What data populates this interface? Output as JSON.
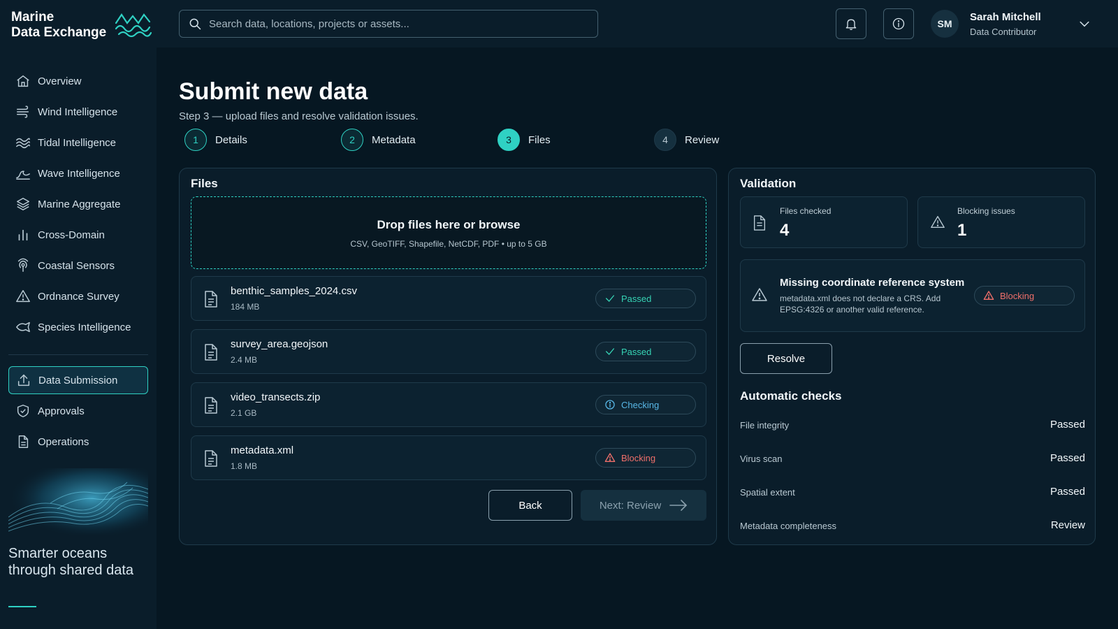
{
  "brand": {
    "line1": "Marine",
    "line2": "Data Exchange"
  },
  "search": {
    "placeholder": "Search data, locations, projects or assets..."
  },
  "user": {
    "initials": "SM",
    "name": "Sarah Mitchell",
    "role": "Data Contributor"
  },
  "sidebar": {
    "items": [
      {
        "label": "Overview",
        "icon": "home-icon"
      },
      {
        "label": "Wind Intelligence",
        "icon": "wind-icon"
      },
      {
        "label": "Tidal Intelligence",
        "icon": "tidal-icon"
      },
      {
        "label": "Wave Intelligence",
        "icon": "wave-icon"
      },
      {
        "label": "Marine Aggregate",
        "icon": "layers-icon"
      },
      {
        "label": "Cross-Domain",
        "icon": "bar-chart-icon"
      },
      {
        "label": "Coastal Sensors",
        "icon": "sensor-icon"
      },
      {
        "label": "Ordnance Survey",
        "icon": "warning-icon"
      },
      {
        "label": "Species Intelligence",
        "icon": "fish-icon"
      }
    ],
    "secondary": [
      {
        "label": "Data Submission",
        "icon": "upload-icon",
        "active": true
      },
      {
        "label": "Approvals",
        "icon": "shield-check-icon"
      },
      {
        "label": "Operations",
        "icon": "document-icon"
      }
    ],
    "tagline": "Smarter oceans through shared data"
  },
  "page": {
    "title": "Submit new data",
    "subtitle": "Step 3 — upload files and resolve validation issues."
  },
  "steps": [
    {
      "num": "1",
      "label": "Details",
      "state": "done"
    },
    {
      "num": "2",
      "label": "Metadata",
      "state": "done"
    },
    {
      "num": "3",
      "label": "Files",
      "state": "current"
    },
    {
      "num": "4",
      "label": "Review",
      "state": "future"
    }
  ],
  "files_panel": {
    "title": "Files",
    "drop_title": "Drop files here or browse",
    "drop_sub": "CSV, GeoTIFF, Shapefile, NetCDF, PDF • up to 5 GB",
    "files": [
      {
        "name": "benthic_samples_2024.csv",
        "size": "184 MB",
        "status": "Passed"
      },
      {
        "name": "survey_area.geojson",
        "size": "2.4 MB",
        "status": "Passed"
      },
      {
        "name": "video_transects.zip",
        "size": "2.1 GB",
        "status": "Checking"
      },
      {
        "name": "metadata.xml",
        "size": "1.8 MB",
        "status": "Blocking"
      }
    ],
    "back_label": "Back",
    "next_label": "Next: Review"
  },
  "validation": {
    "title": "Validation",
    "files_checked_label": "Files checked",
    "files_checked_value": "4",
    "blocking_label": "Blocking issues",
    "blocking_value": "1",
    "issue_title": "Missing coordinate reference system",
    "issue_desc": "metadata.xml does not declare a CRS. Add EPSG:4326 or another valid reference.",
    "issue_badge": "Blocking",
    "resolve_label": "Resolve",
    "auto_title": "Automatic checks",
    "checks": [
      {
        "name": "File integrity",
        "value": "Passed"
      },
      {
        "name": "Virus scan",
        "value": "Passed"
      },
      {
        "name": "Spatial extent",
        "value": "Passed"
      },
      {
        "name": "Metadata completeness",
        "value": "Review"
      }
    ]
  },
  "colors": {
    "accent": "#2fd1c3",
    "passed": "#36d3b4",
    "checking": "#58b7e6",
    "blocking": "#ef6f6a",
    "background": "#061722"
  }
}
